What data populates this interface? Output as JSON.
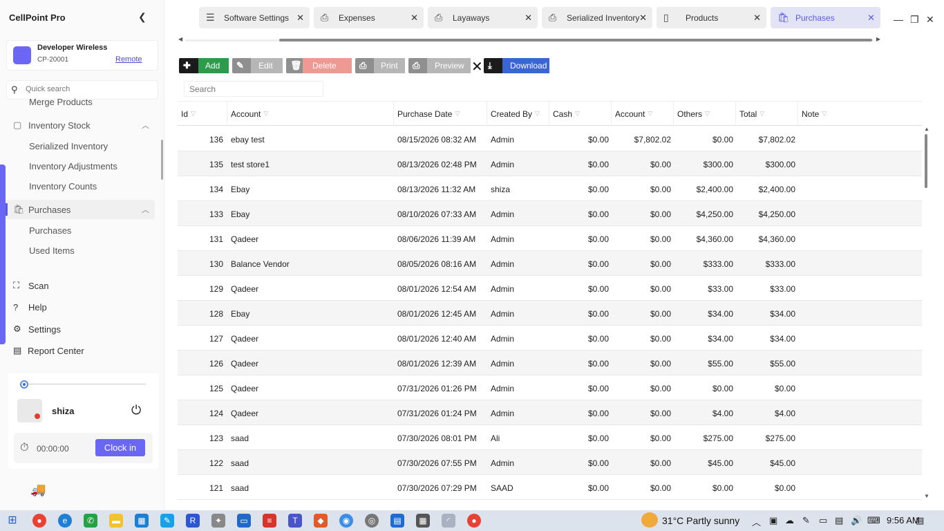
{
  "app": {
    "title": "CellPoint Pro"
  },
  "store": {
    "name": "Developer Wireless",
    "code": "CP-20001",
    "mode": "Remote"
  },
  "quick_search": {
    "placeholder": "Quick search"
  },
  "nav": {
    "merge_products": "Merge Products",
    "inventory_stock": "Inventory Stock",
    "serialized_inventory": "Serialized Inventory",
    "inventory_adjustments": "Inventory Adjustments",
    "inventory_counts": "Inventory Counts",
    "purchases": "Purchases",
    "purchases_sub": "Purchases",
    "used_items": "Used Items",
    "scan": "Scan",
    "help": "Help",
    "settings": "Settings",
    "report_center": "Report Center"
  },
  "user": {
    "name": "shiza",
    "timer": "00:00:00",
    "clock_in": "Clock in"
  },
  "tabs": [
    {
      "label": "Software Settings",
      "icon": "sliders-icon"
    },
    {
      "label": "Expenses",
      "icon": "printer-icon"
    },
    {
      "label": "Layaways",
      "icon": "printer-icon"
    },
    {
      "label": "Serialized Inventory",
      "icon": "printer-icon"
    },
    {
      "label": "Products",
      "icon": "document-icon"
    },
    {
      "label": "Purchases",
      "icon": "basket-icon",
      "active": true
    }
  ],
  "toolbar": {
    "add": "Add",
    "edit": "Edit",
    "delete": "Delete",
    "print": "Print",
    "preview": "Preview",
    "download": "Download"
  },
  "grid_search": {
    "placeholder": "Search"
  },
  "columns": [
    "Id",
    "Account",
    "Purchase Date",
    "Created By",
    "Cash",
    "Account",
    "Others",
    "Total",
    "Note"
  ],
  "rows": [
    [
      "136",
      "ebay test",
      "08/15/2026 08:32 AM",
      "Admin",
      "$0.00",
      "$7,802.02",
      "$0.00",
      "$7,802.02",
      ""
    ],
    [
      "135",
      "test store1",
      "08/13/2026 02:48 PM",
      "Admin",
      "$0.00",
      "$0.00",
      "$300.00",
      "$300.00",
      ""
    ],
    [
      "134",
      "Ebay",
      "08/13/2026 11:32 AM",
      "shiza",
      "$0.00",
      "$0.00",
      "$2,400.00",
      "$2,400.00",
      ""
    ],
    [
      "133",
      "Ebay",
      "08/10/2026 07:33 AM",
      "Admin",
      "$0.00",
      "$0.00",
      "$4,250.00",
      "$4,250.00",
      ""
    ],
    [
      "131",
      "Qadeer",
      "08/06/2026 11:39 AM",
      "Admin",
      "$0.00",
      "$0.00",
      "$4,360.00",
      "$4,360.00",
      ""
    ],
    [
      "130",
      "Balance Vendor",
      "08/05/2026 08:16 AM",
      "Admin",
      "$0.00",
      "$0.00",
      "$333.00",
      "$333.00",
      ""
    ],
    [
      "129",
      "Qadeer",
      "08/01/2026 12:54 AM",
      "Admin",
      "$0.00",
      "$0.00",
      "$33.00",
      "$33.00",
      ""
    ],
    [
      "128",
      "Ebay",
      "08/01/2026 12:45 AM",
      "Admin",
      "$0.00",
      "$0.00",
      "$34.00",
      "$34.00",
      ""
    ],
    [
      "127",
      "Qadeer",
      "08/01/2026 12:40 AM",
      "Admin",
      "$0.00",
      "$0.00",
      "$34.00",
      "$34.00",
      ""
    ],
    [
      "126",
      "Qadeer",
      "08/01/2026 12:39 AM",
      "Admin",
      "$0.00",
      "$0.00",
      "$55.00",
      "$55.00",
      ""
    ],
    [
      "125",
      "Qadeer",
      "07/31/2026 01:26 PM",
      "Admin",
      "$0.00",
      "$0.00",
      "$0.00",
      "$0.00",
      ""
    ],
    [
      "124",
      "Qadeer",
      "07/31/2026 01:24 PM",
      "Admin",
      "$0.00",
      "$0.00",
      "$4.00",
      "$4.00",
      ""
    ],
    [
      "123",
      "saad",
      "07/30/2026 08:01 PM",
      "Ali",
      "$0.00",
      "$0.00",
      "$275.00",
      "$275.00",
      ""
    ],
    [
      "122",
      "saad",
      "07/30/2026 07:55 PM",
      "Admin",
      "$0.00",
      "$0.00",
      "$45.00",
      "$45.00",
      ""
    ],
    [
      "121",
      "saad",
      "07/30/2026 07:29 PM",
      "SAAD",
      "$0.00",
      "$0.00",
      "$0.00",
      "$0.00",
      ""
    ]
  ],
  "taskbar": {
    "weather": "31°C  Partly sunny",
    "time": "9:56 AM"
  },
  "colors": {
    "accent": "#6a67f5",
    "add": "#2e9a4c",
    "delete": "#ec9a92",
    "download": "#3a66d3"
  }
}
